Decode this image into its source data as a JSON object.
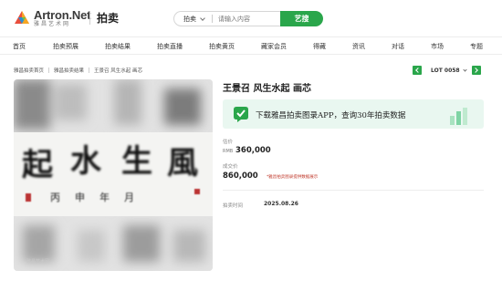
{
  "header": {
    "logo_en": "Artron.Net",
    "logo_cn": "雅昌艺术网",
    "section_title": "拍卖",
    "search": {
      "category": "拍卖",
      "placeholder": "请输入内容",
      "button_label": "艺搜"
    }
  },
  "nav": {
    "items": [
      "首页",
      "拍卖预展",
      "拍卖结果",
      "拍卖直播",
      "拍卖黄页",
      "藏家会员",
      "得藏",
      "资讯",
      "对话",
      "市场",
      "专题"
    ]
  },
  "breadcrumb": {
    "items": [
      "雅昌拍卖首页",
      "雅昌拍卖结果",
      "王景召 风生水起 画芯"
    ]
  },
  "lot_nav": {
    "label": "LOT 0058"
  },
  "artwork": {
    "title": "王景召 风生水起 画芯",
    "calligraphy": [
      "風",
      "生",
      "水",
      "起"
    ],
    "inscription": "丙申年月",
    "watermark": "雅昌艺术网"
  },
  "banner": {
    "text": "下载雅昌拍卖图录APP，查询30年拍卖数据"
  },
  "estimate": {
    "label": "估价",
    "currency": "RMB",
    "value": "360,000"
  },
  "deal": {
    "label": "成交价",
    "currency": "RMB",
    "value": "860,000",
    "note": "*雅昌拍卖图录提供数据展示"
  },
  "auction_time": {
    "label": "拍卖时间",
    "value": "2025.08.26"
  },
  "colors": {
    "accent": "#2aa64b",
    "banner_bg": "#e9f7f0",
    "note": "#c0392b"
  }
}
